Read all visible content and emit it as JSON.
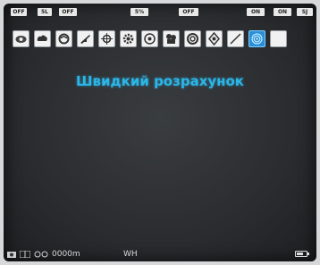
{
  "status_labels": {
    "s1": "OFF",
    "s2": "5L",
    "s3": "OFF",
    "s4": "5%",
    "s5": "OFF",
    "s6": "ON",
    "s7": "ON",
    "s8": "SJ"
  },
  "title": "Швидкий розрахунок",
  "bottom": {
    "distance": "0000m",
    "mode": "WH",
    "battery_level": 0.7
  },
  "icons": [
    {
      "name": "range-icon"
    },
    {
      "name": "cloud-icon"
    },
    {
      "name": "swirl-icon"
    },
    {
      "name": "rifle-icon"
    },
    {
      "name": "crosshair-icon"
    },
    {
      "name": "gear-icon"
    },
    {
      "name": "target-icon"
    },
    {
      "name": "camera-icon"
    },
    {
      "name": "scope-icon"
    },
    {
      "name": "shield-icon"
    },
    {
      "name": "slash-icon"
    },
    {
      "name": "wifi-icon",
      "selected": true
    },
    {
      "name": "blank-icon"
    }
  ],
  "colors": {
    "title": "#2bb6e8",
    "selected": "#2a8fd8"
  }
}
